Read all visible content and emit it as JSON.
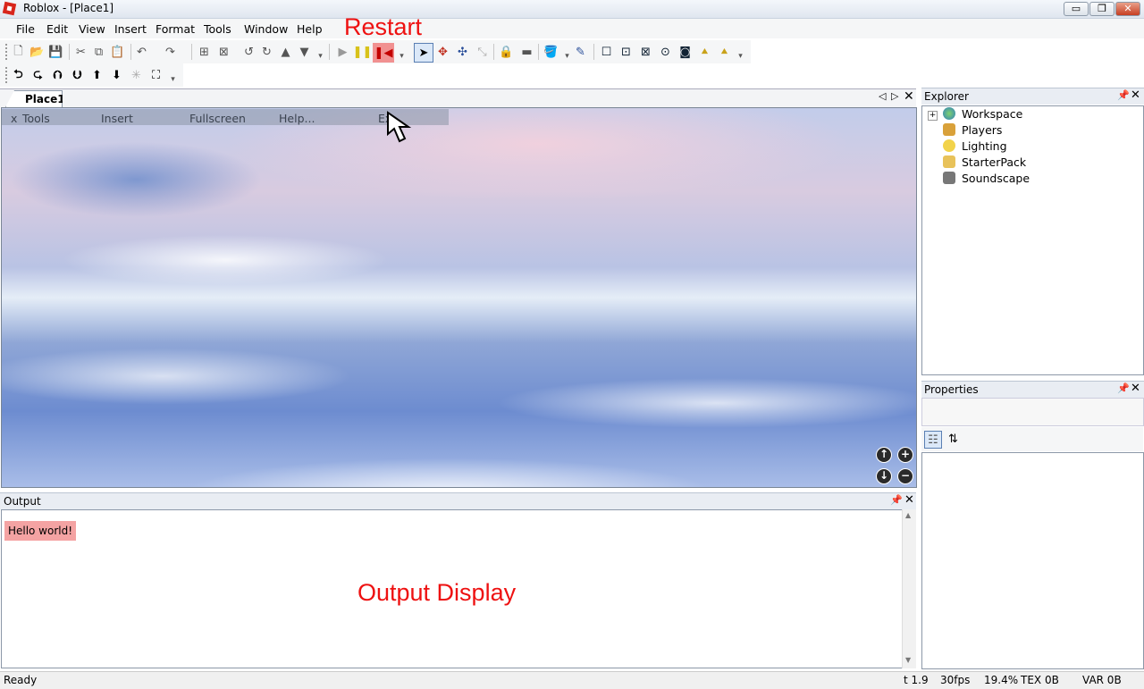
{
  "window": {
    "title": "Roblox - [Place1]",
    "minimize": "▭",
    "maximize": "❐",
    "close": "✕"
  },
  "menu": [
    "File",
    "Edit",
    "View",
    "Insert",
    "Format",
    "Tools",
    "Window",
    "Help"
  ],
  "annotations": {
    "restart": "Restart",
    "output_display": "Output Display"
  },
  "toolbar1": {
    "icons": [
      "new-file-icon",
      "open-folder-icon",
      "save-icon",
      "cut-icon",
      "copy-icon",
      "paste-icon",
      "undo-icon",
      "redo-icon",
      "group-icon",
      "ungroup-icon",
      "rotate-left-icon",
      "rotate-right-icon",
      "tilt-up-icon",
      "tilt-down-icon",
      "play-icon",
      "pause-icon",
      "reset-icon",
      "select-icon",
      "move-icon",
      "drag-icon",
      "resize-icon",
      "lock-icon",
      "anchor-icon",
      "paint-bucket-icon",
      "dropper-icon",
      "surface-smooth-icon",
      "surface-glue-icon",
      "surface-weld-icon",
      "surface-studs-icon",
      "surface-inlet-icon",
      "surface-hinge-icon",
      "surface-motor-icon"
    ]
  },
  "toolbar2": {
    "icons": [
      "camera-left-icon",
      "camera-right-icon",
      "camera-tilt-up-icon",
      "camera-tilt-down-icon",
      "camera-up-icon",
      "camera-down-icon",
      "zoom-extents-icon",
      "fullscreen-icon"
    ]
  },
  "document": {
    "tab": "Place1"
  },
  "viewport_menu": {
    "close": "x",
    "tools": "Tools",
    "insert": "Insert",
    "fullscreen": "Fullscreen",
    "help": "Help...",
    "exit": "Ex"
  },
  "viewport_nav": {
    "up": "↑",
    "zoom_in": "+",
    "down": "↓",
    "zoom_out": "−"
  },
  "output": {
    "title": "Output",
    "messages": [
      "Hello world!"
    ]
  },
  "explorer": {
    "title": "Explorer",
    "items": [
      {
        "label": "Workspace",
        "icon": "globe-icon",
        "color": "#3a9c3c"
      },
      {
        "label": "Players",
        "icon": "players-icon",
        "color": "#d9a13a"
      },
      {
        "label": "Lighting",
        "icon": "lightbulb-icon",
        "color": "#f2d34a"
      },
      {
        "label": "StarterPack",
        "icon": "folder-icon",
        "color": "#e8c25a"
      },
      {
        "label": "Soundscape",
        "icon": "speaker-icon",
        "color": "#777777"
      }
    ]
  },
  "properties": {
    "title": "Properties"
  },
  "status": {
    "left": "Ready",
    "time": "t 1.9",
    "fps": "30fps",
    "percent": "19.4%",
    "tex": "TEX 0B",
    "var": "VAR 0B"
  },
  "colors": {
    "annotation": "#ee1111",
    "highlight": "#f4a3a3"
  }
}
